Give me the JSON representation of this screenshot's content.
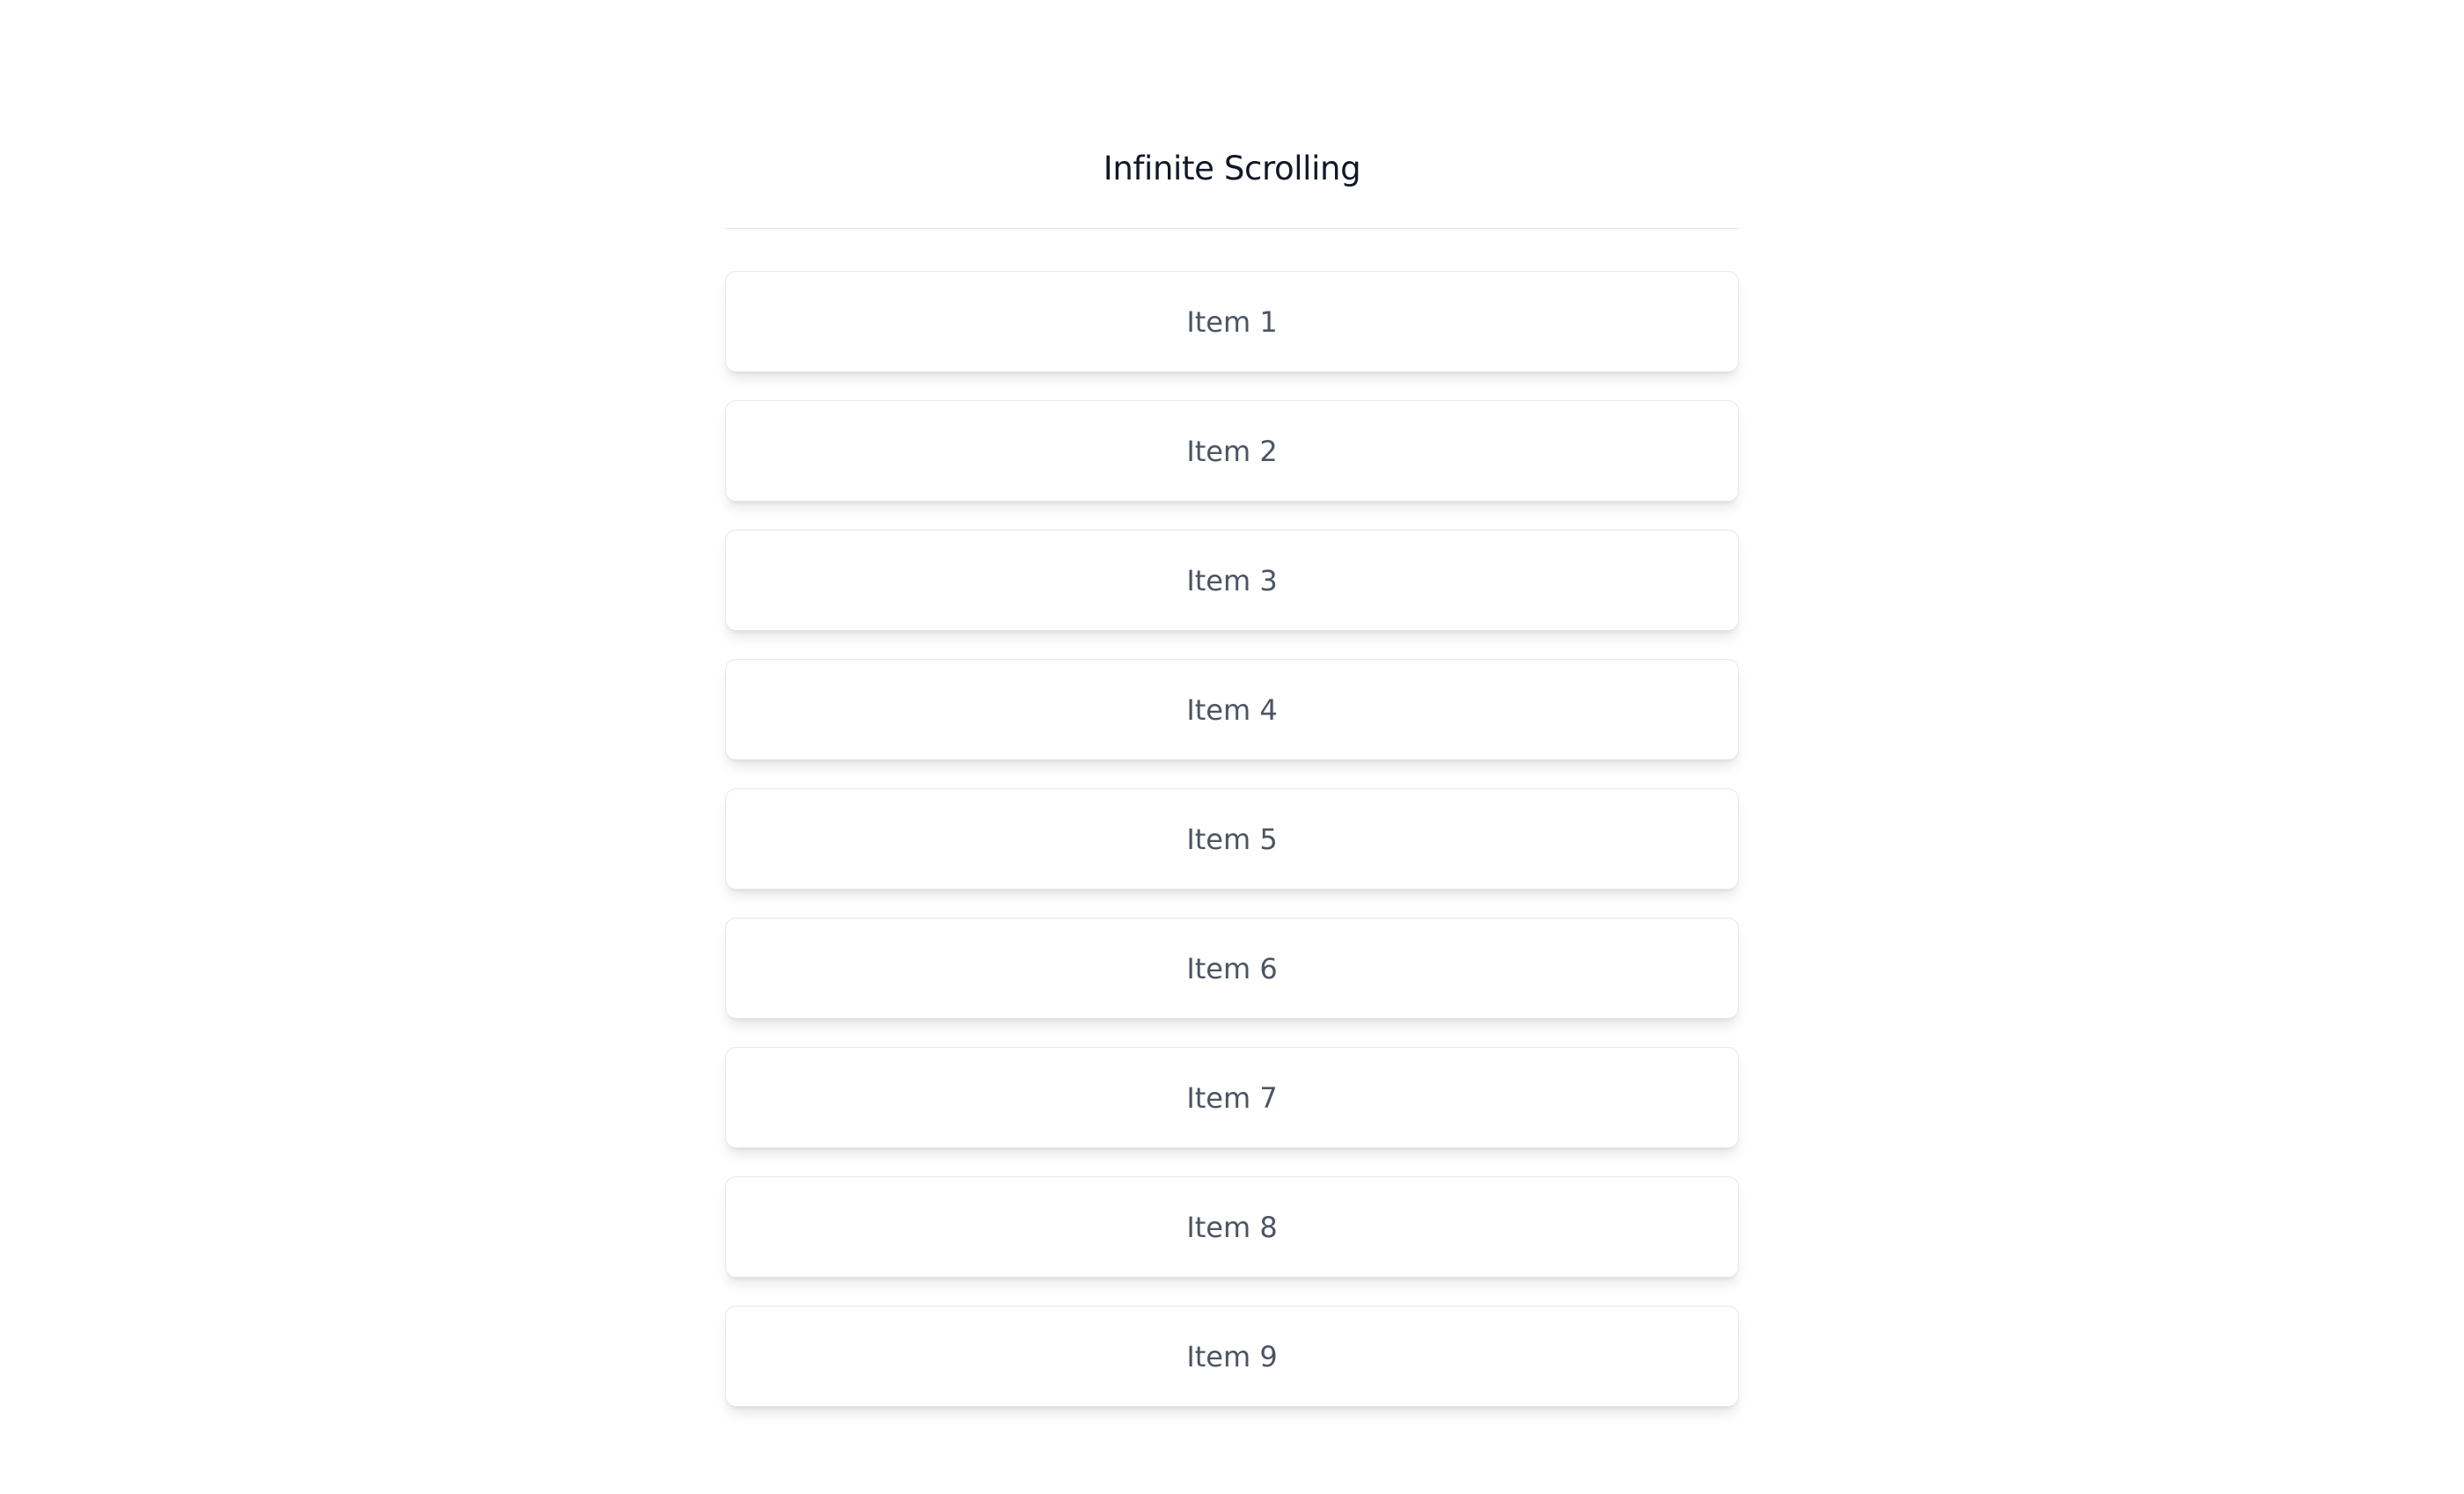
{
  "header": {
    "title": "Infinite Scrolling"
  },
  "list": {
    "items": [
      {
        "label": "Item 1"
      },
      {
        "label": "Item 2"
      },
      {
        "label": "Item 3"
      },
      {
        "label": "Item 4"
      },
      {
        "label": "Item 5"
      },
      {
        "label": "Item 6"
      },
      {
        "label": "Item 7"
      },
      {
        "label": "Item 8"
      },
      {
        "label": "Item 9"
      }
    ]
  }
}
